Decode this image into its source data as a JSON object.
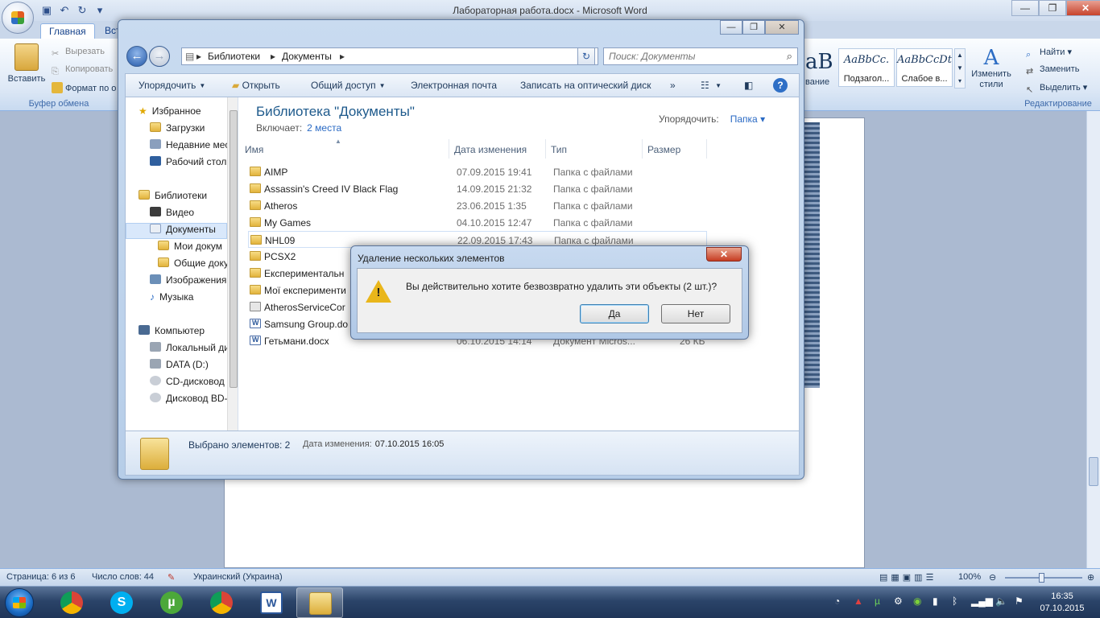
{
  "word": {
    "title": "Лабораторная работа.docx - Microsoft Word",
    "tabs": [
      "Главная",
      "Вст"
    ],
    "clipboard": {
      "paste": "Вставить",
      "cut": "Вырезать",
      "copy": "Копировать",
      "format": "Формат по о",
      "group": "Буфер обмена"
    },
    "styles": [
      {
        "sample": "AaBbCc.",
        "label": "Подзагол..."
      },
      {
        "sample": "AaBbCcDt",
        "label": "Слабое в..."
      }
    ],
    "style_partial": {
      "sample": "aB",
      "label": "вание"
    },
    "change_styles": "Изменить стили",
    "editing": {
      "find": "Найти",
      "replace": "Заменить",
      "select": "Выделить",
      "group": "Редактирование"
    },
    "status": {
      "page": "Страница: 6 из 6",
      "words": "Число слов: 44",
      "language": "Украинский (Украина)",
      "zoom": "100%"
    }
  },
  "explorer": {
    "breadcrumb": [
      "Библиотеки",
      "Документы"
    ],
    "search_placeholder": "Поиск: Документы",
    "commands": {
      "organize": "Упорядочить",
      "open": "Открыть",
      "share": "Общий доступ",
      "email": "Электронная почта",
      "burn": "Записать на оптический диск",
      "more": "»"
    },
    "nav": {
      "favorites": "Избранное",
      "downloads": "Загрузки",
      "recent": "Недавние мес",
      "desktop": "Рабочий стол",
      "libraries": "Библиотеки",
      "video": "Видео",
      "documents": "Документы",
      "my_docs": "Мои докум",
      "public_docs": "Общие доку",
      "images": "Изображения",
      "music": "Музыка",
      "computer": "Компьютер",
      "local_disk": "Локальный ди",
      "data_disk": "DATA (D:)",
      "cd_drive": "CD-дисковод",
      "bd_drive": "Дисковод BD-"
    },
    "library_title": "Библиотека \"Документы\"",
    "includes_label": "Включает:",
    "includes_link": "2 места",
    "arrange_label": "Упорядочить:",
    "arrange_value": "Папка",
    "columns": [
      "Имя",
      "Дата изменения",
      "Тип",
      "Размер"
    ],
    "files": [
      {
        "name": "AIMP",
        "date": "07.09.2015 19:41",
        "type": "Папка с файлами",
        "size": "",
        "icon": "folder"
      },
      {
        "name": "Assassin's Creed IV Black Flag",
        "date": "14.09.2015 21:32",
        "type": "Папка с файлами",
        "size": "",
        "icon": "folder"
      },
      {
        "name": "Atheros",
        "date": "23.06.2015 1:35",
        "type": "Папка с файлами",
        "size": "",
        "icon": "folder"
      },
      {
        "name": "My Games",
        "date": "04.10.2015 12:47",
        "type": "Папка с файлами",
        "size": "",
        "icon": "folder"
      },
      {
        "name": "NHL09",
        "date": "22.09.2015 17:43",
        "type": "Папка с файлами",
        "size": "",
        "icon": "folder"
      },
      {
        "name": "PCSX2",
        "date": "",
        "type": "",
        "size": "",
        "icon": "folder"
      },
      {
        "name": "Експериментальн",
        "date": "",
        "type": "",
        "size": "",
        "icon": "folder"
      },
      {
        "name": "Мої експерименти",
        "date": "",
        "type": "",
        "size": "",
        "icon": "folder"
      },
      {
        "name": "AtherosServiceCor",
        "date": "",
        "type": "",
        "size": "",
        "icon": "config"
      },
      {
        "name": "Samsung Group.do",
        "date": "",
        "type": "",
        "size": "",
        "icon": "doc"
      },
      {
        "name": "Гетьмани.docx",
        "date": "06.10.2015 14:14",
        "type": "Документ Micros...",
        "size": "26 КБ",
        "icon": "doc"
      }
    ],
    "details": {
      "selected": "Выбрано элементов: 2",
      "date_label": "Дата изменения:",
      "date_value": "07.10.2015 16:05"
    }
  },
  "dialog": {
    "title": "Удаление нескольких элементов",
    "message": "Вы действительно хотите безвозвратно удалить эти объекты (2 шт.)?",
    "yes": "Да",
    "no": "Нет",
    "close": "✕"
  },
  "taskbar": {
    "apps": [
      "chrome-icon",
      "skype-icon",
      "utorrent-icon",
      "chrome-icon",
      "word-icon",
      "explorer-icon"
    ],
    "time": "16:35",
    "date": "07.10.2015"
  },
  "colors": {
    "accent": "#1e5a8c",
    "link": "#2a6ac4",
    "warning": "#e9b61b"
  }
}
